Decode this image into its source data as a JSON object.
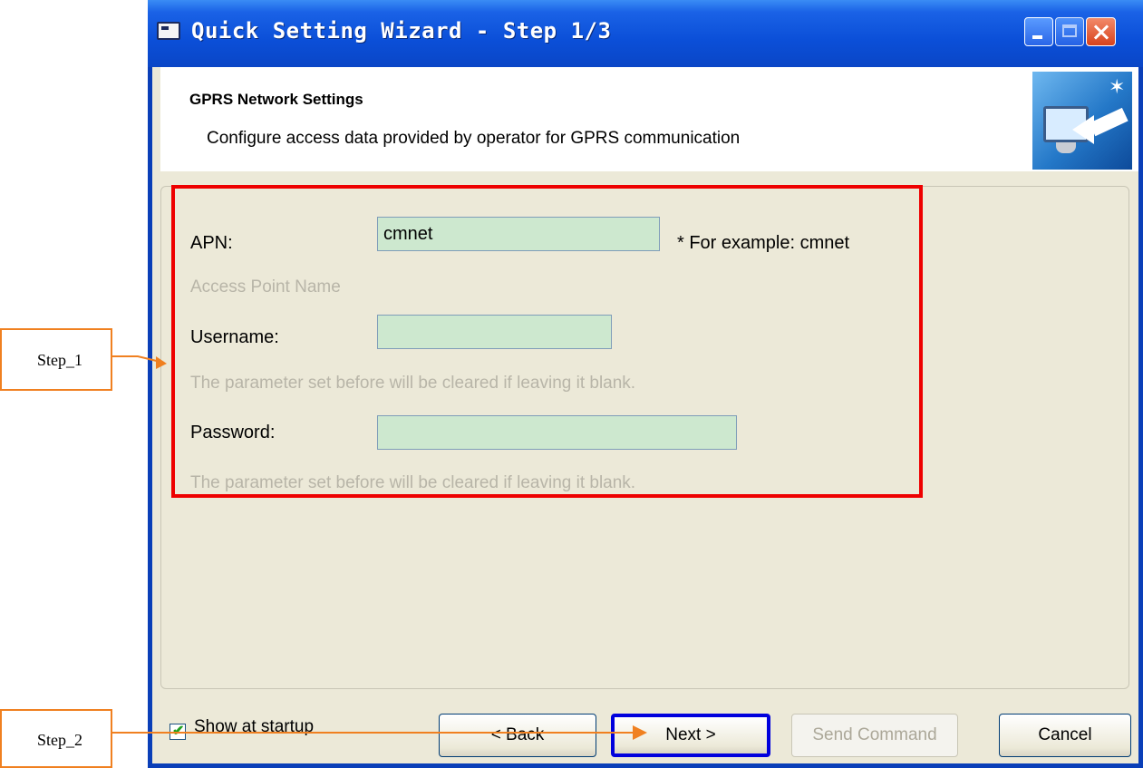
{
  "window": {
    "title": "Quick Setting Wizard - Step 1/3",
    "buttons": [
      "minimize",
      "maximize",
      "close"
    ]
  },
  "header": {
    "title": "GPRS Network Settings",
    "description": "Configure access data provided by operator for GPRS communication",
    "logo_icon": "monitor-arrow-icon"
  },
  "form": {
    "apn_label": "APN:",
    "apn_value": "cmnet",
    "apn_note": "*  For example: cmnet",
    "apn_hint": "Access Point Name",
    "username_label": "Username:",
    "username_value": "",
    "username_hint": "The parameter set before will be cleared if leaving it blank.",
    "password_label": "Password:",
    "password_value": "",
    "password_hint": "The parameter set before will be cleared if leaving it blank."
  },
  "footer": {
    "show_at_startup_label": "Show at startup",
    "show_at_startup_checked": true,
    "back_label": "< Back",
    "next_label": "Next >",
    "send_command_label": "Send Command",
    "send_command_enabled": false,
    "cancel_label": "Cancel"
  },
  "annotations": {
    "step1_label": "Step_1",
    "step2_label": "Step_2",
    "highlight_color": "#ee0000",
    "next_highlight_color": "#0000dd",
    "arrow_color": "#f08020"
  },
  "colors": {
    "titlebar": "#0a4fd8",
    "client": "#ece9d8",
    "field_bg": "#cde8cf"
  }
}
